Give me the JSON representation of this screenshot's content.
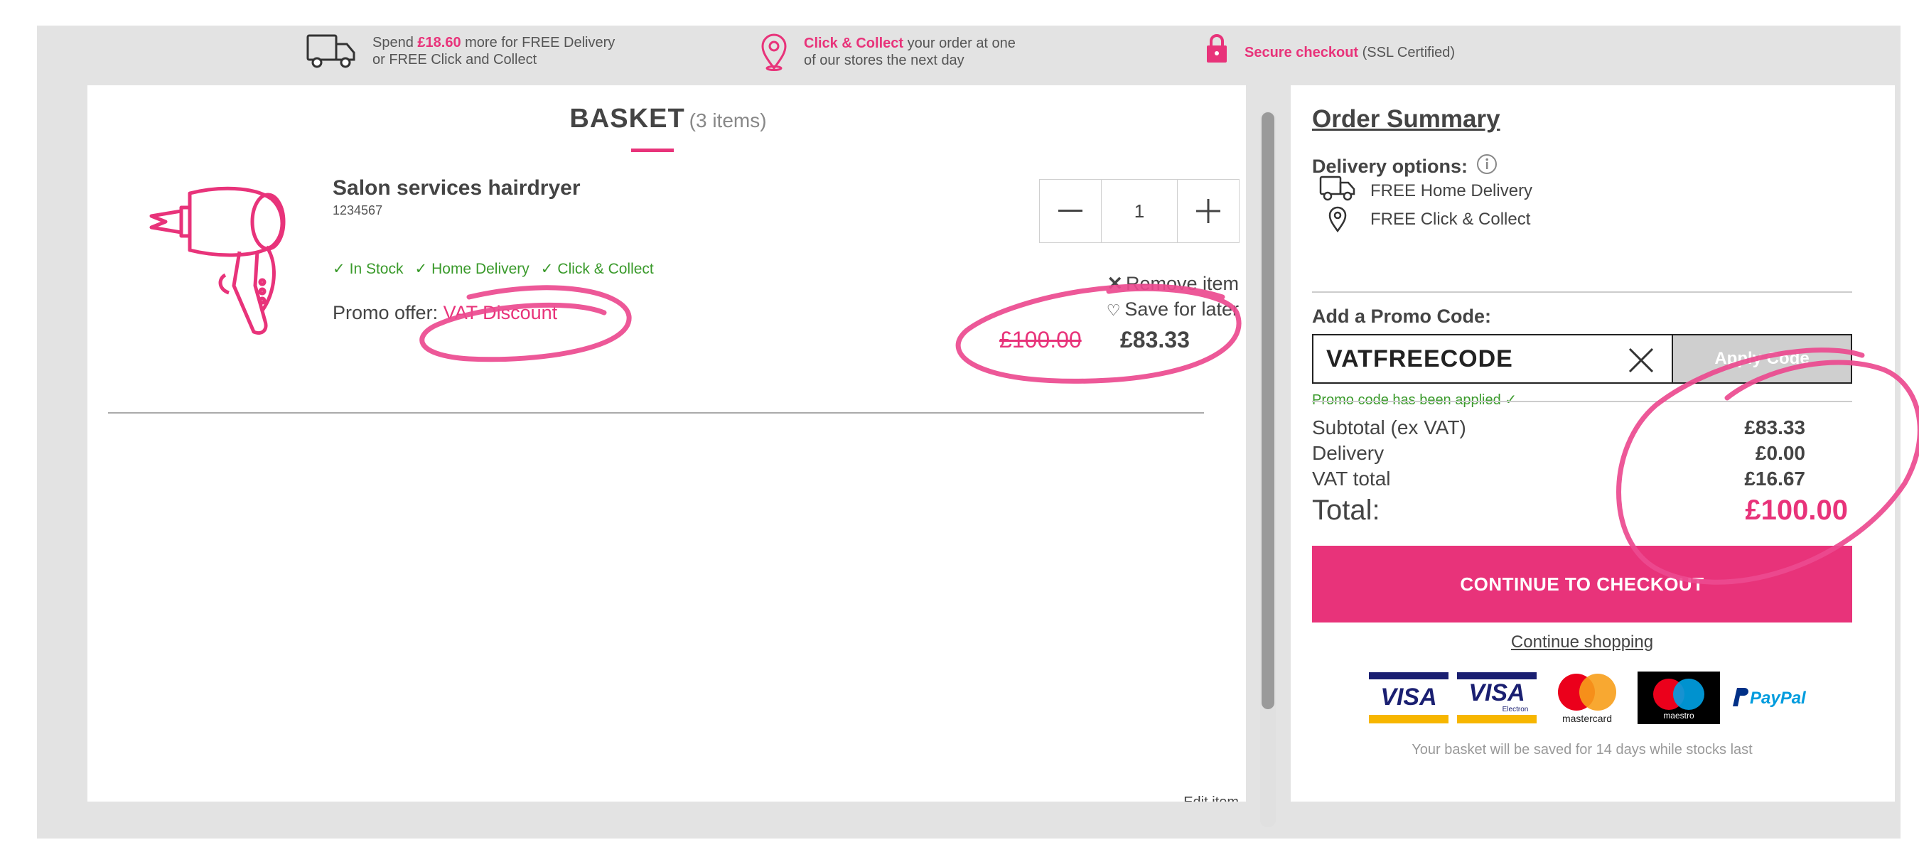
{
  "colors": {
    "accent": "#e8337a",
    "success": "#3a9a2b",
    "frame": "#e3e3e3",
    "text": "#444444"
  },
  "infobar": {
    "delivery": {
      "icon": "truck-icon",
      "pre": "Spend ",
      "amount": "£18.60",
      "post": " more for FREE Delivery",
      "line2": "or FREE Click and Collect"
    },
    "collect": {
      "icon": "location-pin-icon",
      "bold": "Click & Collect",
      "post": " your order at one",
      "line2": "of our stores the next day"
    },
    "secure": {
      "icon": "lock-icon",
      "bold": "Secure checkout",
      "post": " (SSL Certified)"
    }
  },
  "basket": {
    "title": "BASKET",
    "count": "(3 items)",
    "item": {
      "name": "Salon services hairdryer",
      "sku": "1234567",
      "image_icon": "hairdryer-icon",
      "stock": [
        "In Stock",
        "Home Delivery",
        "Click & Collect"
      ],
      "promo_label": "Promo offer: ",
      "promo_value": "VAT Discount",
      "quantity": "1",
      "remove": "Remove item",
      "save": "Save for later",
      "old_price": "£100.00",
      "new_price": "£83.33"
    },
    "next_item_partial": "Edit item"
  },
  "summary": {
    "title": "Order Summary",
    "delivery_label": "Delivery options:",
    "delivery_options": [
      {
        "free": "FREE",
        "label": "Home Delivery",
        "icon": "truck-icon"
      },
      {
        "free": "FREE",
        "label": "Click & Collect",
        "icon": "location-pin-icon"
      }
    ],
    "promo_label": "Add a Promo Code:",
    "promo_code": "VATFREECODE",
    "apply_label": "Apply Code",
    "applied_msg": "Promo code has been applied",
    "rows": [
      {
        "label": "Subtotal (ex VAT)",
        "value": "£83.33"
      },
      {
        "label": "Delivery",
        "value": "£0.00"
      },
      {
        "label": "VAT total",
        "value": "£16.67"
      }
    ],
    "total_label": "Total:",
    "total_value": "£100.00",
    "checkout_label": "CONTINUE TO CHECKOUT",
    "continue_label": "Continue shopping",
    "payment_cards": [
      "VISA",
      "VISA",
      "mastercard",
      "maestro",
      "PayPal"
    ],
    "visa_electron_sub": "Electron",
    "saved_msg": "Your basket will be saved for 14 days while stocks last"
  }
}
